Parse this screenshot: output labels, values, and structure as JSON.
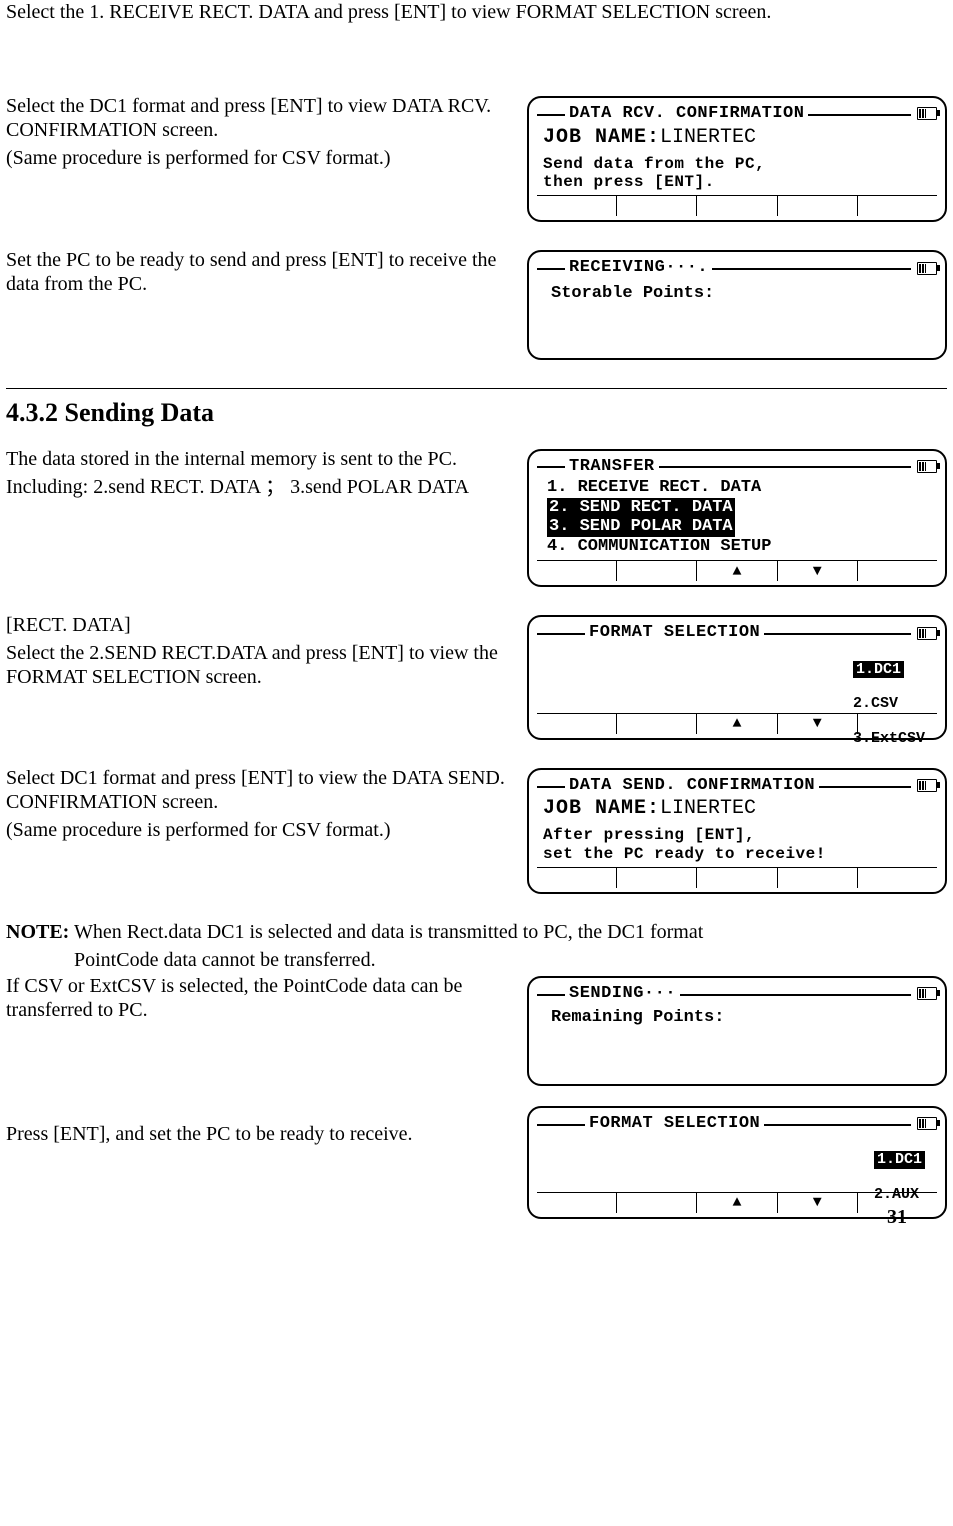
{
  "intro": {
    "p1": "Select the 1. RECEIVE RECT. DATA and press [ENT] to view FORMAT SELECTION screen."
  },
  "step1": {
    "p1": "Select the DC1 format and press [ENT] to view DATA RCV. CONFIRMATION screen.",
    "p2": "(Same procedure is performed for CSV format.)",
    "screen": {
      "title": "DATA RCV. CONFIRMATION",
      "job_label": "JOB NAME:",
      "job_value": "LINERTEC",
      "msg1": "Send data from the PC,",
      "msg2": "then press [ENT]."
    }
  },
  "step2": {
    "p1": "Set the PC to be ready to send and press [ENT] to receive the data from the PC.",
    "screen": {
      "title": "RECEIVING···.",
      "body": "Storable Points:"
    }
  },
  "section_title": "4.3.2 Sending Data",
  "step3": {
    "p1": "The data stored in the internal memory is sent to the PC.",
    "p2": "Including: 2.send RECT. DATA ； 3.send POLAR DATA",
    "screen": {
      "title": "TRANSFER",
      "m1": "1. RECEIVE RECT. DATA",
      "m2": "2. SEND RECT. DATA",
      "m3": "3. SEND POLAR DATA",
      "m4": "4. COMMUNICATION SETUP"
    }
  },
  "step4": {
    "h": "[RECT. DATA]",
    "p1": "Select the 2.SEND RECT.DATA and press [ENT] to view the FORMAT SELECTION screen.",
    "screen": {
      "title": "FORMAT SELECTION",
      "o1": "1.DC1",
      "o2": "2.CSV",
      "o3": "3.ExtCSV"
    }
  },
  "step5": {
    "p1": "Select DC1 format and press [ENT] to view the DATA SEND. CONFIRMATION screen.",
    "p2": "(Same procedure is performed for CSV format.)",
    "screen": {
      "title": "DATA SEND. CONFIRMATION",
      "job_label": "JOB NAME:",
      "job_value": "LINERTEC",
      "msg1": "After pressing [ENT],",
      "msg2": "set the PC ready to receive!"
    }
  },
  "note": {
    "lead": "NOTE:",
    "p1": " When Rect.data DC1 is selected and data is transmitted to PC, the DC1 format",
    "p1b": "PointCode data cannot be transferred.",
    "p2": "If CSV or ExtCSV is selected, the PointCode data can be transferred to PC.",
    "screen": {
      "title": "SENDING···",
      "body": "Remaining Points:"
    }
  },
  "step6": {
    "p1": "Press [ENT], and set the PC to be ready to receive.",
    "screen": {
      "title": "FORMAT SELECTION",
      "o1": "1.DC1",
      "o2": "2.AUX"
    }
  },
  "pagenum": "31"
}
